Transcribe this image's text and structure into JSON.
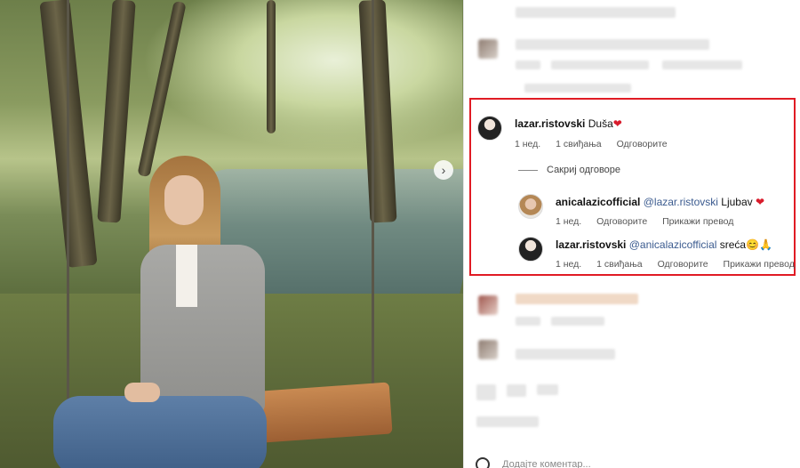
{
  "comments": {
    "main": {
      "username": "lazar.ristovski",
      "text": "Duša",
      "emoji": "❤",
      "time": "1 нед.",
      "likes": "1 свиђања",
      "reply": "Одговорите"
    },
    "hide_replies": "Сакриј одговоре",
    "replies": [
      {
        "username": "anicalazicofficial",
        "mention": "@lazar.ristovski",
        "text": "Ljubav",
        "emoji": "❤",
        "time": "1 нед.",
        "reply": "Одговорите",
        "translate": "Прикажи превод"
      },
      {
        "username": "lazar.ristovski",
        "mention": "@anicalazicofficial",
        "text": "sreća",
        "emoji": "😊🙏",
        "time": "1 нед.",
        "likes": "1 свиђања",
        "reply": "Одговорите",
        "translate": "Прикажи превод"
      }
    ]
  },
  "footer": {
    "add_comment": "Додајте коментар..."
  },
  "colors": {
    "highlight": "#e01b24",
    "mention": "#3b5b8f",
    "heart": "#d91c2c"
  }
}
